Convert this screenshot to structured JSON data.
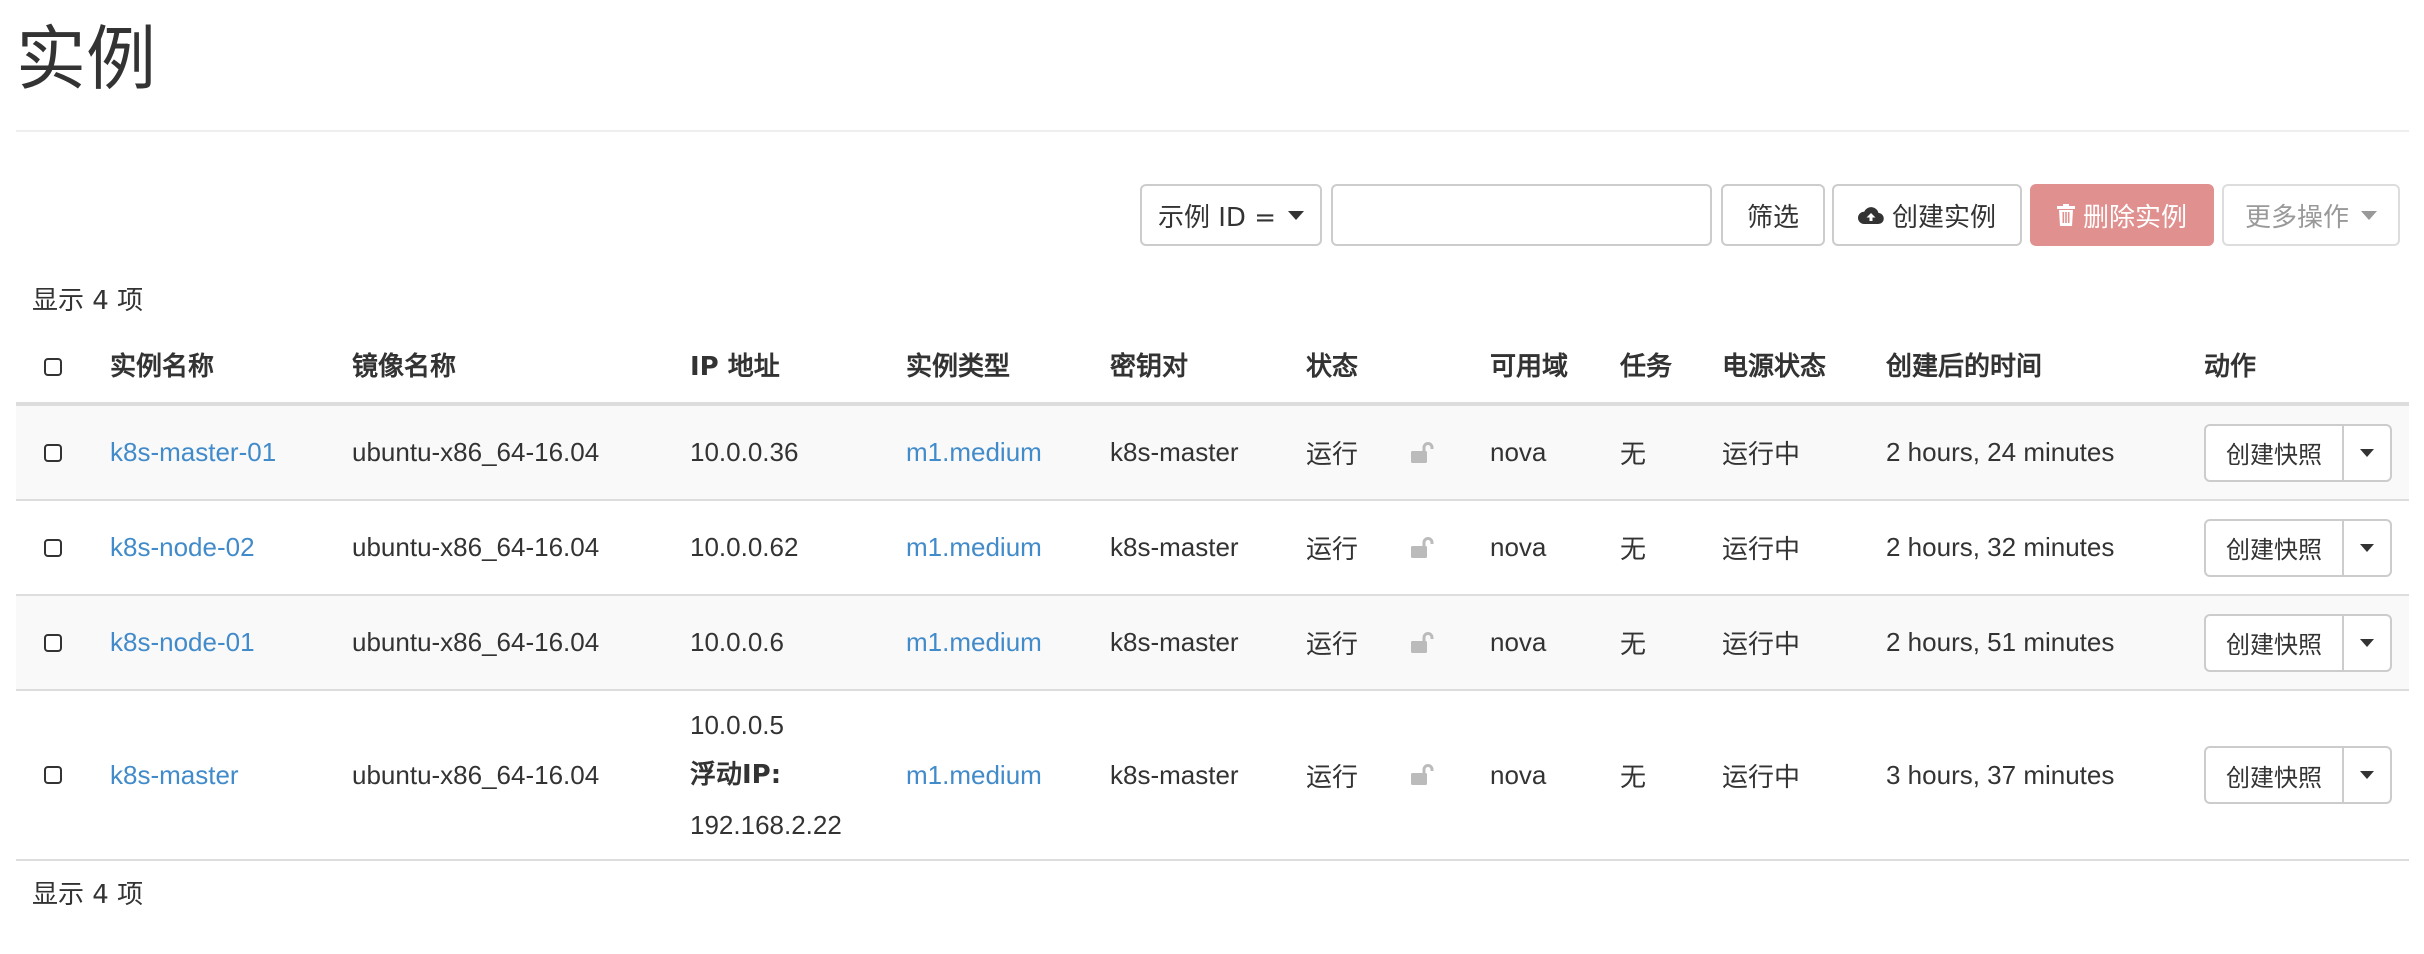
{
  "page": {
    "title": "实例"
  },
  "toolbar": {
    "filter_field_label": "示例 ID =",
    "search_value": "",
    "search_placeholder": "",
    "filter_button": "筛选",
    "create_button": "创建实例",
    "delete_button": "删除实例",
    "more_button": "更多操作"
  },
  "summary": {
    "count_top": "显示 4 项",
    "count_bottom": "显示 4 项"
  },
  "table": {
    "headers": {
      "name": "实例名称",
      "image": "镜像名称",
      "ip": "IP 地址",
      "flavor": "实例类型",
      "keypair": "密钥对",
      "status": "状态",
      "az": "可用域",
      "task": "任务",
      "power": "电源状态",
      "age": "创建后的时间",
      "actions": "动作"
    },
    "rows": [
      {
        "name": "k8s-master-01",
        "image": "ubuntu-x86_64-16.04",
        "ip": "10.0.0.36",
        "floating_label": "",
        "floating_ip": "",
        "flavor": "m1.medium",
        "keypair": "k8s-master",
        "status": "运行",
        "az": "nova",
        "task": "无",
        "power": "运行中",
        "age": "2 hours, 24 minutes",
        "action": "创建快照"
      },
      {
        "name": "k8s-node-02",
        "image": "ubuntu-x86_64-16.04",
        "ip": "10.0.0.62",
        "floating_label": "",
        "floating_ip": "",
        "flavor": "m1.medium",
        "keypair": "k8s-master",
        "status": "运行",
        "az": "nova",
        "task": "无",
        "power": "运行中",
        "age": "2 hours, 32 minutes",
        "action": "创建快照"
      },
      {
        "name": "k8s-node-01",
        "image": "ubuntu-x86_64-16.04",
        "ip": "10.0.0.6",
        "floating_label": "",
        "floating_ip": "",
        "flavor": "m1.medium",
        "keypair": "k8s-master",
        "status": "运行",
        "az": "nova",
        "task": "无",
        "power": "运行中",
        "age": "2 hours, 51 minutes",
        "action": "创建快照"
      },
      {
        "name": "k8s-master",
        "image": "ubuntu-x86_64-16.04",
        "ip": "10.0.0.5",
        "floating_label": "浮动IP:",
        "floating_ip": "192.168.2.22",
        "flavor": "m1.medium",
        "keypair": "k8s-master",
        "status": "运行",
        "az": "nova",
        "task": "无",
        "power": "运行中",
        "age": "3 hours, 37 minutes",
        "action": "创建快照"
      }
    ]
  },
  "icons": {
    "create": "cloud-upload-icon",
    "delete": "trash-icon",
    "lock": "unlock-icon",
    "caret": "caret-down-icon"
  },
  "colors": {
    "link": "#428bca",
    "danger_disabled": "#e0908e",
    "row_stripe": "#f9f9f9",
    "border": "#cccccc"
  }
}
